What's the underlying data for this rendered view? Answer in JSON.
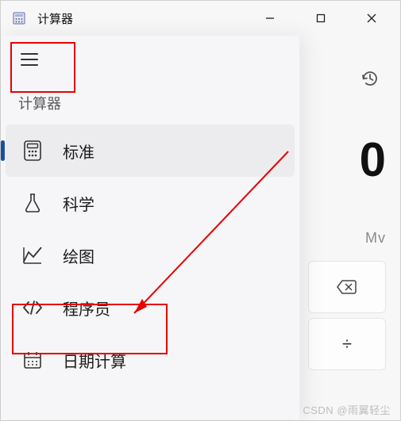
{
  "window": {
    "title": "计算器"
  },
  "nav": {
    "section_label": "计算器",
    "items": [
      {
        "icon": "calculator-icon",
        "label": "标准",
        "selected": true
      },
      {
        "icon": "flask-icon",
        "label": "科学",
        "selected": false
      },
      {
        "icon": "graph-icon",
        "label": "绘图",
        "selected": false
      },
      {
        "icon": "code-icon",
        "label": "程序员",
        "selected": false
      },
      {
        "icon": "calendar-icon",
        "label": "日期计算",
        "selected": false
      }
    ]
  },
  "display": {
    "value": "0"
  },
  "memory": {
    "label": "Mv"
  },
  "keypad": {
    "backspace": "⌫",
    "divide": "÷"
  },
  "watermark": "CSDN @雨翼轻尘"
}
